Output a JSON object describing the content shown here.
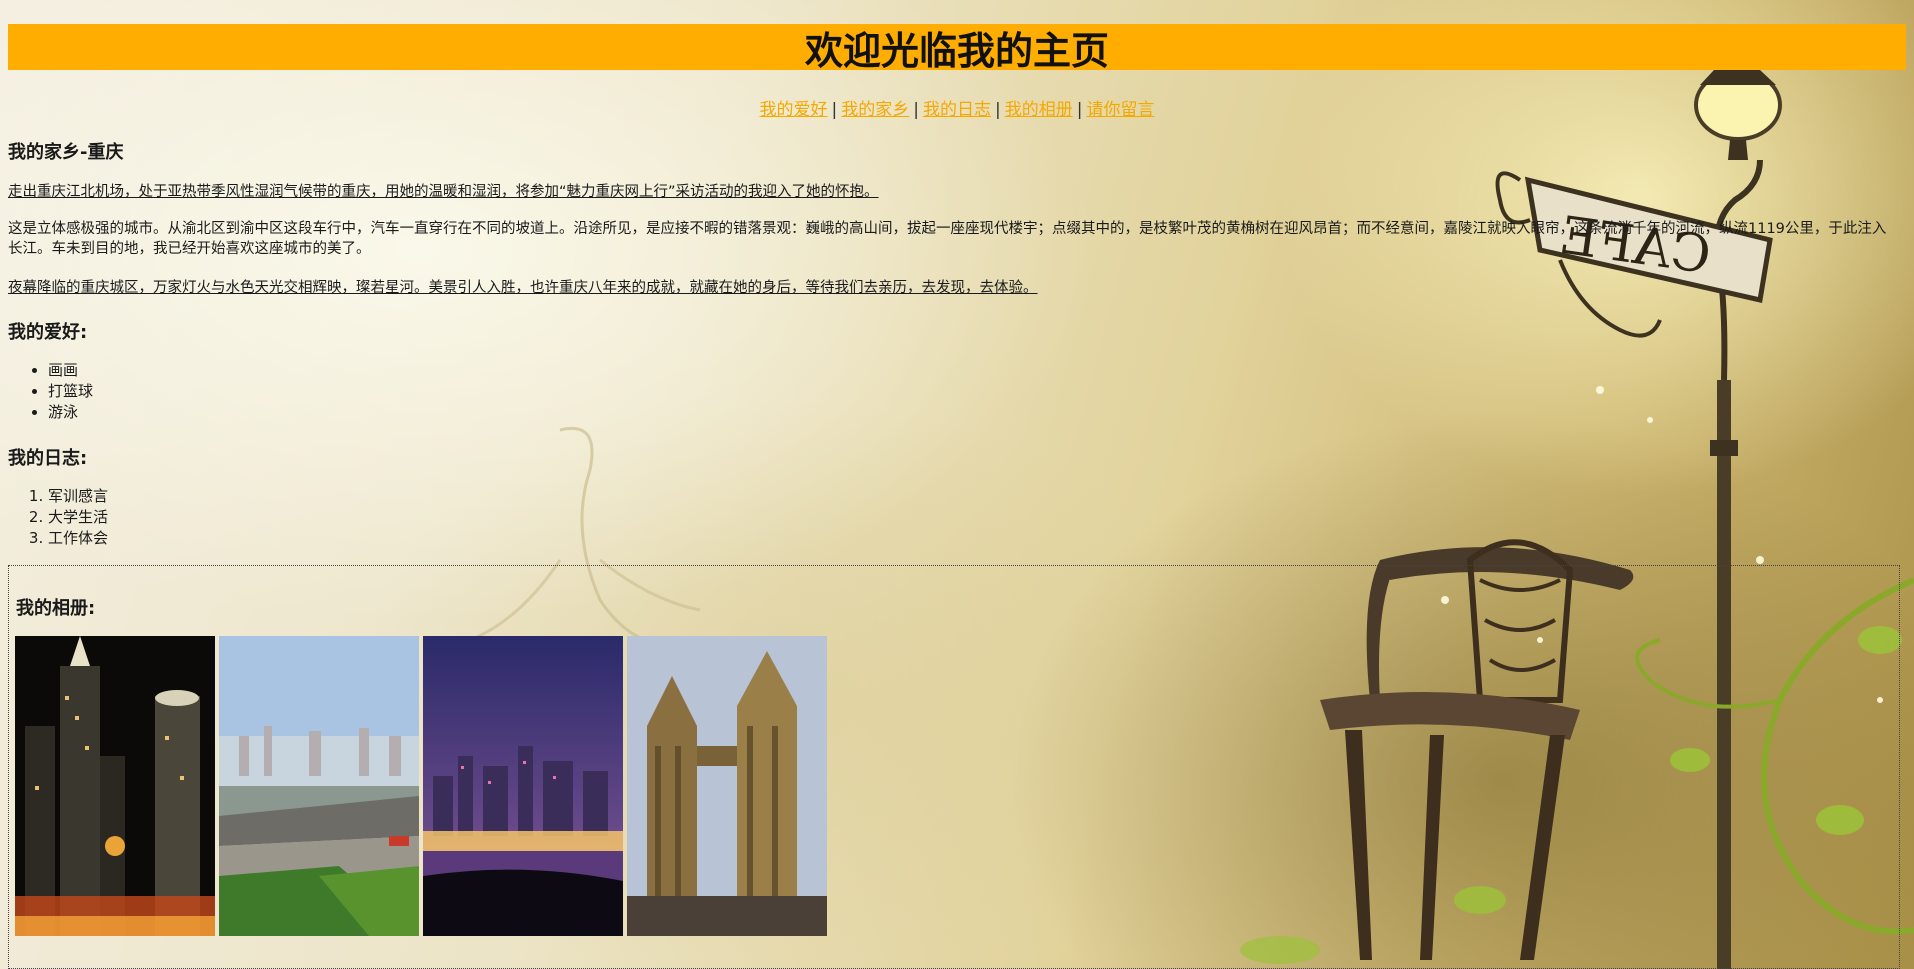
{
  "header": {
    "title": "欢迎光临我的主页"
  },
  "nav": {
    "items": [
      {
        "label": "我的爱好"
      },
      {
        "label": "我的家乡"
      },
      {
        "label": "我的日志"
      },
      {
        "label": "我的相册"
      },
      {
        "label": "请你留言"
      }
    ],
    "separator": "|"
  },
  "hometown": {
    "title": "我的家乡-重庆",
    "paragraphs": [
      "走出重庆江北机场，处于亚热带季风性湿润气候带的重庆，用她的温暖和湿润，将参加“魅力重庆网上行”采访活动的我迎入了她的怀抱。",
      "这是立体感极强的城市。从渝北区到渝中区这段车行中，汽车一直穿行在不同的坡道上。沿途所见，是应接不暇的错落景观：巍峨的高山间，拔起一座座现代楼宇；点缀其中的，是枝繁叶茂的黄桷树在迎风昂首；而不经意间，嘉陵江就映入眼帘，这条流淌千年的河流，纵流1119公里，于此注入长江。车未到目的地，我已经开始喜欢这座城市的美了。",
      "夜幕降临的重庆城区，万家灯火与水色天光交相辉映，璨若星河。美景引人入胜，也许重庆八年来的成就，就藏在她的身后，等待我们去亲历，去发现，去体验。"
    ]
  },
  "hobbies": {
    "title": "我的爱好:",
    "items": [
      "画画",
      "打篮球",
      "游泳"
    ]
  },
  "diary": {
    "title": "我的日志:",
    "items": [
      "军训感言",
      "大学生活",
      "工作体会"
    ]
  },
  "album": {
    "title": "我的相册:",
    "photos": [
      {
        "icon": "night-skyline-photo"
      },
      {
        "icon": "river-bridge-photo"
      },
      {
        "icon": "night-riverside-photo"
      },
      {
        "icon": "twin-towers-photo"
      }
    ]
  },
  "colors": {
    "banner": "#ffad00",
    "nav_link": "#f5a800"
  }
}
